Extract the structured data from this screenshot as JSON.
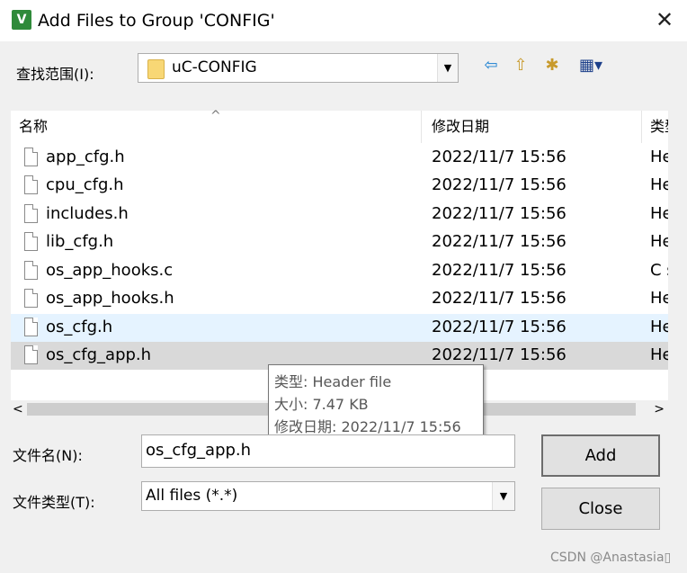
{
  "title": "Add Files to Group 'CONFIG'",
  "app_icon": {
    "name": "uvision-icon",
    "glyph": "V"
  },
  "close_glyph": "✕",
  "look_in": {
    "label": "查找范围(I):",
    "value": "uC-CONFIG"
  },
  "toolbar": {
    "back": "⇦",
    "up": "⇧",
    "new_folder": "✱",
    "view": "▦▾"
  },
  "columns": {
    "name": "名称",
    "date": "修改日期",
    "type": "类型"
  },
  "files": [
    {
      "name": "app_cfg.h",
      "date": "2022/11/7 15:56",
      "type": "He"
    },
    {
      "name": "cpu_cfg.h",
      "date": "2022/11/7 15:56",
      "type": "He"
    },
    {
      "name": "includes.h",
      "date": "2022/11/7 15:56",
      "type": "He"
    },
    {
      "name": "lib_cfg.h",
      "date": "2022/11/7 15:56",
      "type": "He"
    },
    {
      "name": "os_app_hooks.c",
      "date": "2022/11/7 15:56",
      "type": "C s"
    },
    {
      "name": "os_app_hooks.h",
      "date": "2022/11/7 15:56",
      "type": "He"
    },
    {
      "name": "os_cfg.h",
      "date": "2022/11/7 15:56",
      "type": "He"
    },
    {
      "name": "os_cfg_app.h",
      "date": "2022/11/7 15:56",
      "type": "He"
    }
  ],
  "tooltip": {
    "type_line": "类型: Header file",
    "size_line": "大小: 7.47 KB",
    "date_line": "修改日期: 2022/11/7 15:56"
  },
  "file_name": {
    "label": "文件名(N):",
    "value": "os_cfg_app.h"
  },
  "file_type": {
    "label": "文件类型(T):",
    "value": "All files (*.*)"
  },
  "buttons": {
    "add": "Add",
    "close": "Close"
  },
  "watermark": "CSDN @Anastasia▯"
}
